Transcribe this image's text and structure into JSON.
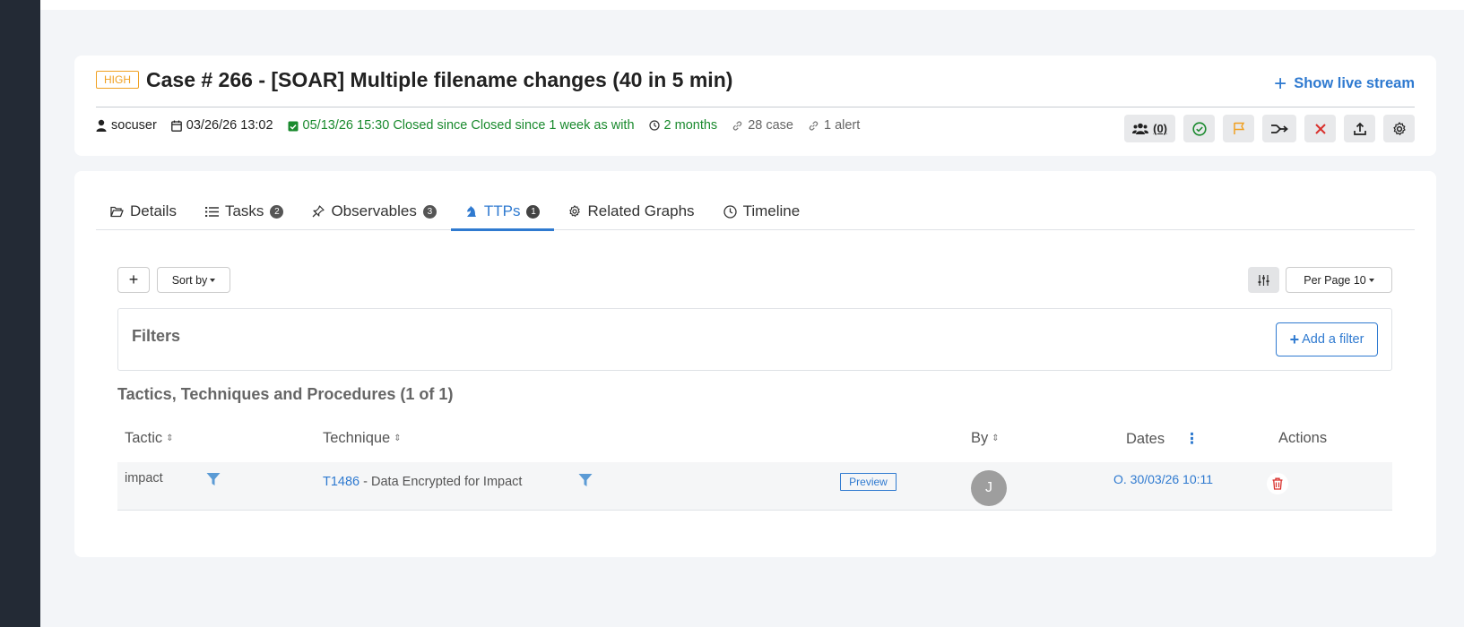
{
  "case": {
    "severity": "HIGH",
    "title": "Case # 266 - [SOAR] Multiple filename changes (40 in 5 min)",
    "live_stream_label": "Show live stream",
    "user": "socuser",
    "created": "03/26/26 13:02",
    "closed": "05/13/26 15:30 Closed since Closed since 1 week as  with",
    "duration": "2 months",
    "cases_link": "28 case",
    "alerts_link": "1 alert",
    "actions": {
      "sharing_count": "(0)"
    }
  },
  "tabs": [
    {
      "label": "Details",
      "icon": "folder-open-icon"
    },
    {
      "label": "Tasks",
      "badge": "2",
      "icon": "list-icon"
    },
    {
      "label": "Observables",
      "badge": "3",
      "icon": "pin-icon"
    },
    {
      "label": "TTPs",
      "badge": "1",
      "icon": "chess-knight-icon",
      "active": true
    },
    {
      "label": "Related Graphs",
      "icon": "gear-icon"
    },
    {
      "label": "Timeline",
      "icon": "clock-icon"
    }
  ],
  "toolbar": {
    "add_label": "+",
    "sort_label": "Sort by",
    "per_page_label": "Per Page 10"
  },
  "filters": {
    "title": "Filters",
    "add_label": "Add a filter"
  },
  "ttps": {
    "title": "Tactics, Techniques and Procedures (1 of 1)",
    "columns": {
      "tactic": "Tactic",
      "technique": "Technique",
      "by": "By",
      "dates": "Dates",
      "actions": "Actions"
    },
    "rows": [
      {
        "tactic": "impact",
        "technique_id": "T1486",
        "technique_name": " - Data Encrypted for Impact",
        "preview_label": "Preview",
        "by_initial": "J",
        "date": "O. 30/03/26 10:11"
      }
    ]
  },
  "colors": {
    "accent": "#2f7ad0",
    "severity_high": "#f0a020",
    "success": "#1a8a2e",
    "danger": "#d9302c",
    "sidebar": "#232a35"
  }
}
